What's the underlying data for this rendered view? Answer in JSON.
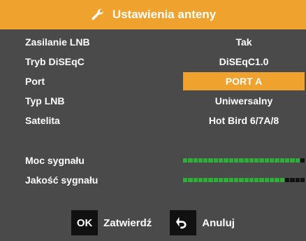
{
  "header": {
    "title": "Ustawienia anteny",
    "icon": "wrench-icon"
  },
  "settings": [
    {
      "label": "Zasilanie LNB",
      "value": "Tak"
    },
    {
      "label": "Tryb DiSEqC",
      "value": "DiSEqC1.0"
    },
    {
      "label": "Port",
      "value": "PORT A",
      "selected": true
    },
    {
      "label": "Typ LNB",
      "value": "Uniwersalny"
    },
    {
      "label": "Satelita",
      "value": "Hot Bird 6/7A/8"
    }
  ],
  "signal": {
    "strength": {
      "label": "Moc sygnału",
      "level": 0.95
    },
    "quality": {
      "label": "Jakość sygnału",
      "level": 0.85
    }
  },
  "footer": {
    "ok_key": "OK",
    "ok_label": "Zatwierdź",
    "back_icon": "back-arrow-icon",
    "back_label": "Anuluj"
  },
  "colors": {
    "accent": "#f0a22e",
    "background": "#4a4a4a",
    "meter_on": "#2fae3a",
    "meter_off": "#111111"
  }
}
